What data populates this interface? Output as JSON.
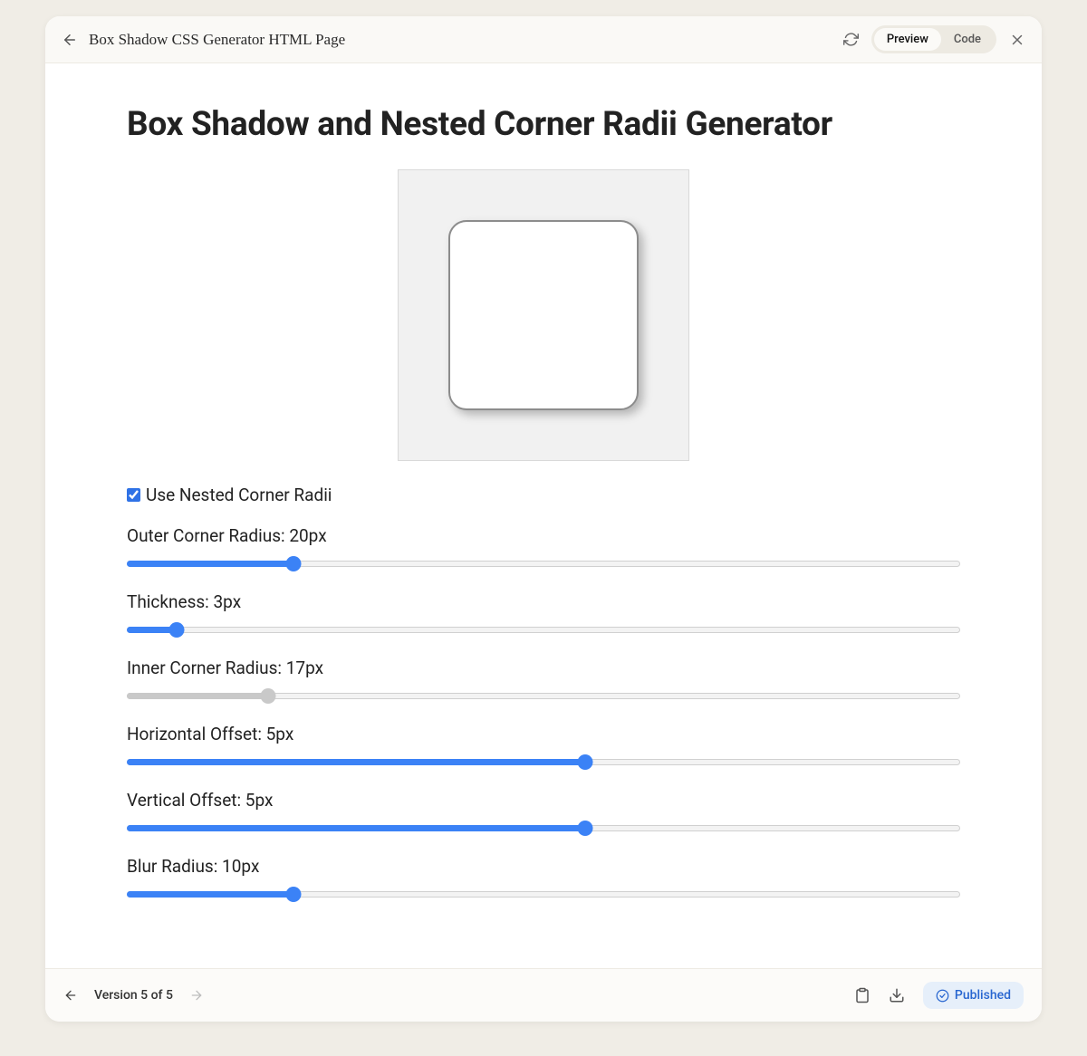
{
  "titlebar": {
    "title": "Box Shadow CSS Generator HTML Page",
    "tabs": {
      "preview": "Preview",
      "code": "Code"
    }
  },
  "page": {
    "heading": "Box Shadow and Nested Corner Radii Generator",
    "checkbox_label": "Use Nested Corner Radii",
    "checkbox_checked": true
  },
  "controls": [
    {
      "key": "outer_radius",
      "label_prefix": "Outer Corner Radius: ",
      "value": 20,
      "unit": "px",
      "min": 0,
      "max": 100,
      "percent": 20,
      "disabled": false
    },
    {
      "key": "thickness",
      "label_prefix": "Thickness: ",
      "value": 3,
      "unit": "px",
      "min": 0,
      "max": 50,
      "percent": 6,
      "disabled": false
    },
    {
      "key": "inner_radius",
      "label_prefix": "Inner Corner Radius: ",
      "value": 17,
      "unit": "px",
      "min": 0,
      "max": 100,
      "percent": 17,
      "disabled": true
    },
    {
      "key": "h_offset",
      "label_prefix": "Horizontal Offset: ",
      "value": 5,
      "unit": "px",
      "min": -50,
      "max": 50,
      "percent": 55,
      "disabled": false
    },
    {
      "key": "v_offset",
      "label_prefix": "Vertical Offset: ",
      "value": 5,
      "unit": "px",
      "min": -50,
      "max": 50,
      "percent": 55,
      "disabled": false
    },
    {
      "key": "blur",
      "label_prefix": "Blur Radius: ",
      "value": 10,
      "unit": "px",
      "min": 0,
      "max": 50,
      "percent": 20,
      "disabled": false
    }
  ],
  "footer": {
    "version": "Version 5 of 5",
    "status": "Published"
  }
}
